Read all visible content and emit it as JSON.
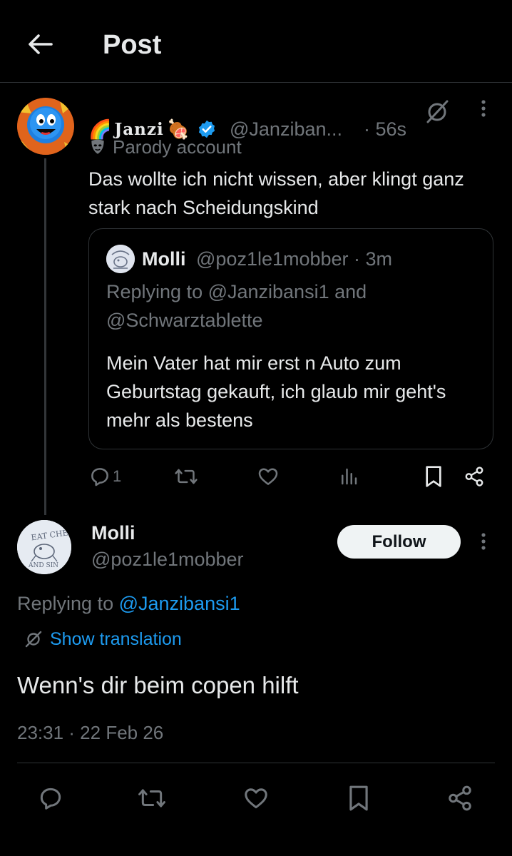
{
  "header": {
    "title": "Post",
    "back_icon": "arrow-left-icon"
  },
  "parent_tweet": {
    "display_name": "Janzi",
    "emojis": [
      "🌈",
      "🍖"
    ],
    "handle": "@Janziban...",
    "time": "· 56s",
    "parody_label": "Parody account",
    "text": "Das wollte ich nicht wissen, aber klingt ganz stark nach Scheidungskind",
    "quote": {
      "name": "Molli",
      "handle_time": "@poz1le1mobber · 3m",
      "replying": "Replying to @Janzibansi1 and @Schwarztablette",
      "text": "Mein Vater hat mir erst n Auto zum Geburtstag gekauft, ich glaub mir geht's mehr als bestens"
    },
    "reply_count": "1"
  },
  "main_tweet": {
    "name": "Molli",
    "handle": "@poz1le1mobber",
    "follow_label": "Follow",
    "replying_prefix": "Replying to ",
    "replying_mention": "@Janzibansi1",
    "translation_label": "Show translation",
    "text": "Wenn's dir beim copen hilft",
    "timestamp": "23:31 · 22 Feb 26"
  },
  "colors": {
    "accent": "#1d9bf0",
    "muted": "#71767b",
    "text": "#e7e9ea",
    "background": "#000000",
    "border": "#2f3336"
  }
}
